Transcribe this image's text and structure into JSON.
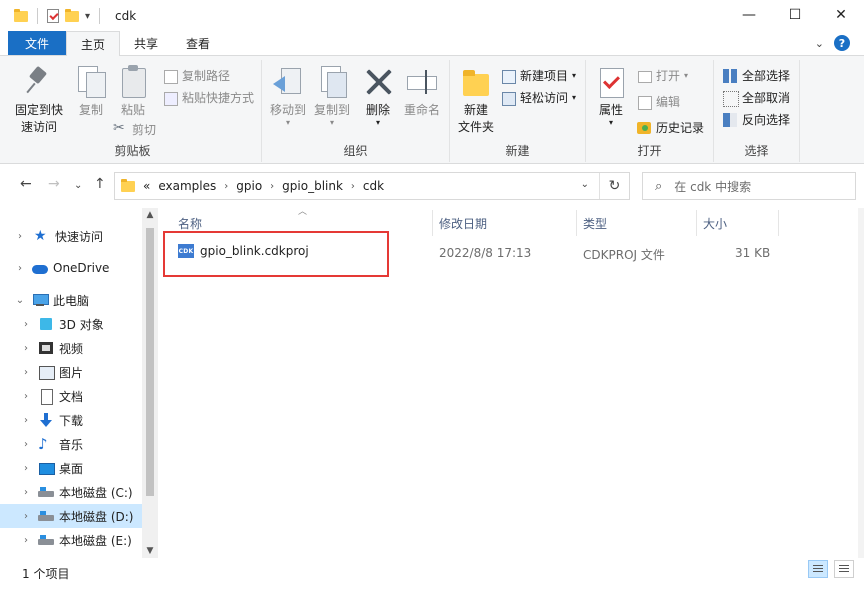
{
  "window": {
    "title": "cdk",
    "minimize": "—",
    "maximize": "☐",
    "close": "✕"
  },
  "ribbon_tabs": [
    {
      "label": "文件"
    },
    {
      "label": "主页"
    },
    {
      "label": "共享"
    },
    {
      "label": "查看"
    }
  ],
  "ribbon": {
    "clipboard": {
      "label": "剪贴板",
      "pin_quick": "固定到快速访问",
      "pin_line1": "固定到快",
      "pin_line2": "速访问",
      "copy": "复制",
      "paste": "粘贴",
      "copy_path": "复制路径",
      "paste_shortcut": "粘贴快捷方式",
      "cut": "剪切"
    },
    "organize": {
      "label": "组织",
      "move_to": "移动到",
      "copy_to": "复制到",
      "delete": "删除",
      "rename": "重命名"
    },
    "new": {
      "label": "新建",
      "new_folder_line1": "新建",
      "new_folder_line2": "文件夹",
      "new_item": "新建项目",
      "easy_access": "轻松访问"
    },
    "open": {
      "label": "打开",
      "properties": "属性",
      "open": "打开",
      "edit": "编辑",
      "history": "历史记录"
    },
    "select": {
      "label": "选择",
      "select_all": "全部选择",
      "select_none": "全部取消",
      "invert": "反向选择"
    }
  },
  "address": {
    "prefix": "«",
    "crumbs": [
      "examples",
      "gpio",
      "gpio_blink",
      "cdk"
    ]
  },
  "search": {
    "placeholder": "在 cdk 中搜索"
  },
  "nav": {
    "items": [
      {
        "label": "快速访问"
      },
      {
        "label": "OneDrive"
      },
      {
        "label": "此电脑"
      },
      {
        "label": "3D 对象"
      },
      {
        "label": "视频"
      },
      {
        "label": "图片"
      },
      {
        "label": "文档"
      },
      {
        "label": "下载"
      },
      {
        "label": "音乐"
      },
      {
        "label": "桌面"
      },
      {
        "label": "本地磁盘 (C:)"
      },
      {
        "label": "本地磁盘 (D:)"
      },
      {
        "label": "本地磁盘 (E:)"
      }
    ]
  },
  "columns": {
    "name": "名称",
    "modified": "修改日期",
    "type": "类型",
    "size": "大小"
  },
  "files": [
    {
      "name": "gpio_blink.cdkproj",
      "icon_text": "CDK",
      "modified": "2022/8/8 17:13",
      "type": "CDKPROJ 文件",
      "size": "31 KB"
    }
  ],
  "status": {
    "count": "1 个项目"
  },
  "colors": {
    "file_tab": "#1a6fc5",
    "selection": "#cce8ff",
    "highlight_box": "#e53935"
  }
}
